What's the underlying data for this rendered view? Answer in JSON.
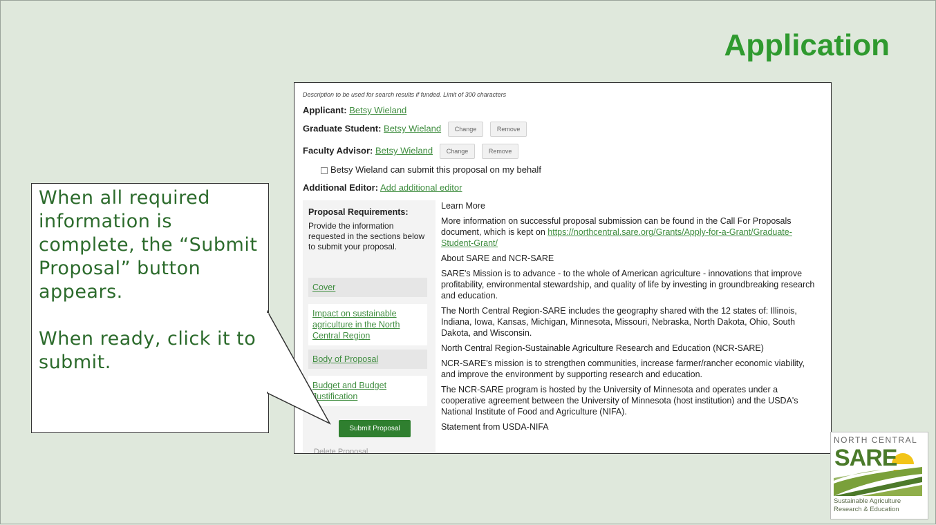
{
  "slide": {
    "title": "Application"
  },
  "form": {
    "description_hint": "Description to be used for search results if funded. Limit of 300 characters",
    "applicant": {
      "label": "Applicant:",
      "name": "Betsy Wieland"
    },
    "graduate_student": {
      "label": "Graduate Student:",
      "name": "Betsy Wieland",
      "change": "Change",
      "remove": "Remove"
    },
    "faculty_advisor": {
      "label": "Faculty Advisor:",
      "name": "Betsy Wieland",
      "change": "Change",
      "remove": "Remove"
    },
    "behalf_checkbox": "Betsy Wieland can submit this proposal on my behalf",
    "additional_editor": {
      "label": "Additional Editor:",
      "link": "Add additional editor"
    }
  },
  "sidebar": {
    "title": "Proposal Requirements:",
    "description": "Provide the information requested in the sections below to submit your proposal.",
    "items": [
      {
        "label": "Cover"
      },
      {
        "label": "Impact on sustainable agriculture in the North Central Region"
      },
      {
        "label": "Body of Proposal"
      },
      {
        "label": "Budget and Budget Justification"
      }
    ],
    "submit": "Submit Proposal",
    "delete": "Delete Proposal"
  },
  "main": {
    "learn_more": "Learn More",
    "info_text": "More information on successful proposal submission can be found in the Call For Proposals document, which is kept on",
    "info_link": "https://northcentral.sare.org/Grants/Apply-for-a-Grant/Graduate-Student-Grant/",
    "about_heading": "About SARE and NCR-SARE",
    "para1": "SARE's Mission is to advance - to the whole of American agriculture - innovations that improve profitability, environmental stewardship, and quality of life by investing in groundbreaking research and education.",
    "para2": "The North Central Region-SARE includes the geography shared with the 12 states of: Illinois, Indiana, Iowa, Kansas, Michigan, Minnesota, Missouri, Nebraska, North Dakota, Ohio, South Dakota, and Wisconsin.",
    "para3": "North Central Region-Sustainable Agriculture Research and Education (NCR-SARE)",
    "para4": "NCR-SARE's mission is to strengthen communities, increase farmer/rancher economic viability, and improve the environment by supporting research and education.",
    "para5": "The NCR-SARE program is hosted by the University of Minnesota and operates under a cooperative agreement between the University of Minnesota (host institution) and the USDA's National Institute of Food and Agriculture (NIFA).",
    "para6": "Statement from USDA-NIFA"
  },
  "callout": {
    "line1": "When all required information is complete, the “Submit Proposal” button appears.",
    "line2": "When ready, click it to submit."
  },
  "logo": {
    "top": "NORTH CENTRAL",
    "name": "SARE",
    "sub1": "Sustainable Agriculture",
    "sub2": "Research & Education"
  }
}
